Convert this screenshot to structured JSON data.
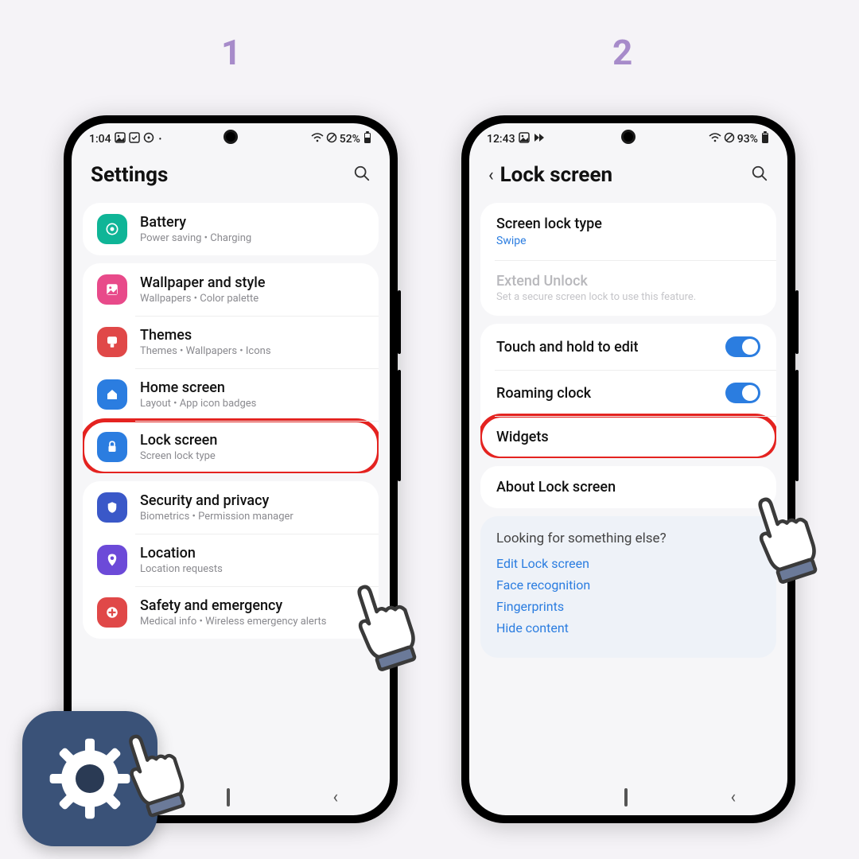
{
  "steps": {
    "one": "1",
    "two": "2"
  },
  "phone1": {
    "status": {
      "time": "1:04",
      "battery": "52%"
    },
    "header": "Settings",
    "items": [
      {
        "title": "Battery",
        "sub": "Power saving  •  Charging"
      },
      {
        "title": "Wallpaper and style",
        "sub": "Wallpapers  •  Color palette"
      },
      {
        "title": "Themes",
        "sub": "Themes  •  Wallpapers  •  Icons"
      },
      {
        "title": "Home screen",
        "sub": "Layout  •  App icon badges"
      },
      {
        "title": "Lock screen",
        "sub": "Screen lock type"
      },
      {
        "title": "Security and privacy",
        "sub": "Biometrics  •  Permission manager"
      },
      {
        "title": "Location",
        "sub": "Location requests"
      },
      {
        "title": "Safety and emergency",
        "sub": "Medical info  •  Wireless emergency alerts"
      }
    ]
  },
  "phone2": {
    "status": {
      "time": "12:43",
      "battery": "93%"
    },
    "header": "Lock screen",
    "lockType": {
      "title": "Screen lock type",
      "value": "Swipe"
    },
    "extend": {
      "title": "Extend Unlock",
      "sub": "Set a secure screen lock to use this feature."
    },
    "rows": {
      "touchHold": "Touch and hold to edit",
      "roaming": "Roaming clock",
      "widgets": "Widgets",
      "about": "About Lock screen"
    },
    "tips": {
      "heading": "Looking for something else?",
      "links": [
        "Edit Lock screen",
        "Face recognition",
        "Fingerprints",
        "Hide content"
      ]
    }
  }
}
